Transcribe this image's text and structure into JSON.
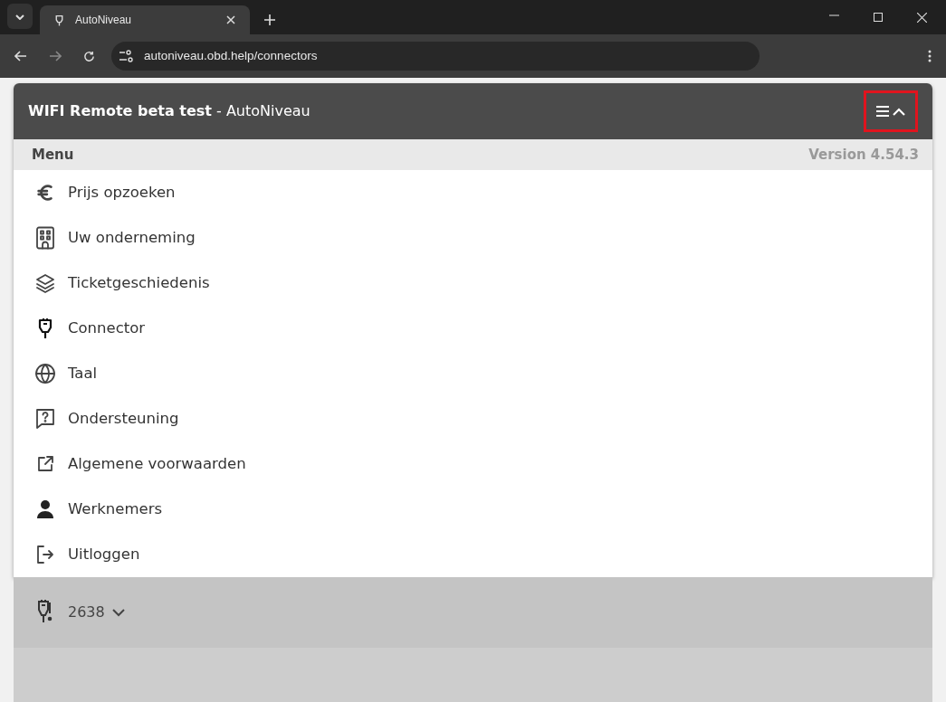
{
  "browser": {
    "tab_title": "AutoNiveau",
    "url": "autoniveau.obd.help/connectors"
  },
  "header": {
    "title_bold": "WIFI Remote beta test",
    "title_rest": " - AutoNiveau",
    "menu_expanded": true,
    "menu_button_highlighted": true
  },
  "menu": {
    "label": "Menu",
    "version": "Version 4.54.3",
    "items": [
      {
        "kind": "euro",
        "label": "Prijs opzoeken"
      },
      {
        "kind": "building",
        "label": "Uw onderneming"
      },
      {
        "kind": "layers",
        "label": "Ticketgeschiedenis"
      },
      {
        "kind": "plug",
        "label": "Connector"
      },
      {
        "kind": "globe",
        "label": "Taal"
      },
      {
        "kind": "help",
        "label": "Ondersteuning"
      },
      {
        "kind": "external",
        "label": "Algemene voorwaarden"
      },
      {
        "kind": "person",
        "label": "Werknemers"
      },
      {
        "kind": "logout",
        "label": "Uitloggen"
      }
    ]
  },
  "connector": {
    "label": "2638"
  }
}
